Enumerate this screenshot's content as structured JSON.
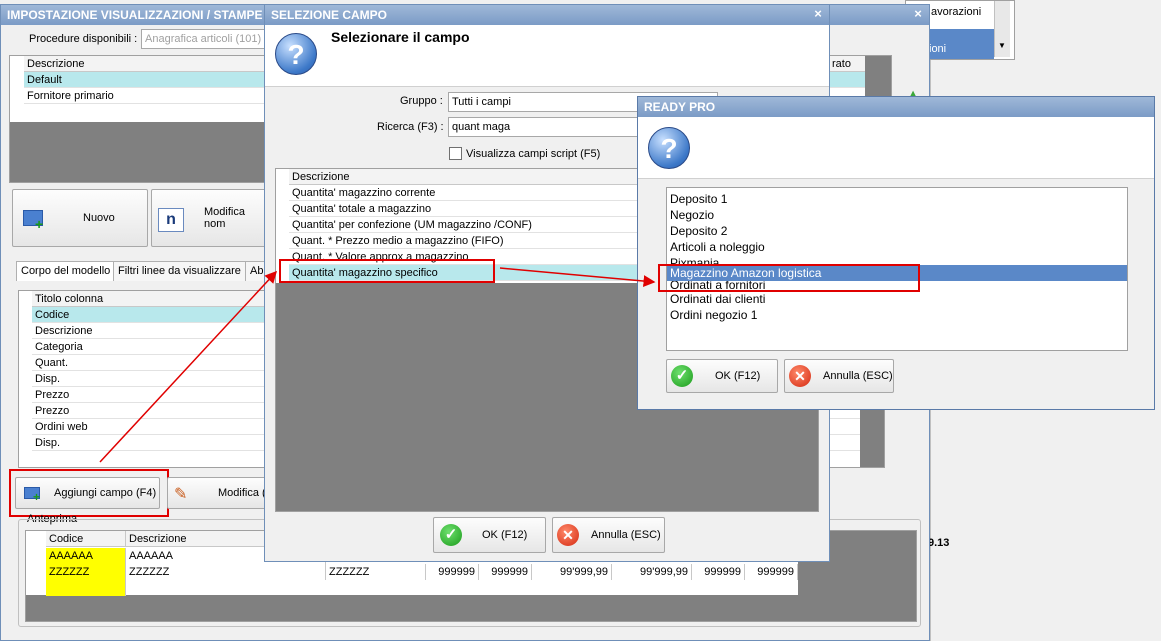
{
  "main_window": {
    "title": "IMPOSTAZIONE VISUALIZZAZIONI / STAMPE",
    "procedure_label": "Procedure disponibili :",
    "procedure_value": "Anagrafica articoli (101)",
    "grid_header": "Descrizione",
    "grid_header_right": "rato",
    "grid_rows": [
      "Default",
      "Fornitore primario"
    ],
    "btn_new": "Nuovo",
    "btn_rename": "Modifica nom",
    "tabs": [
      "Corpo del modello",
      "Filtri linee da visualizzare",
      "Abi"
    ],
    "columns_header": "Titolo colonna",
    "columns_rows": [
      "Codice",
      "Descrizione",
      "Categoria",
      "Quant.",
      "Disp.",
      "Prezzo",
      "Prezzo",
      "Ordini web",
      "Disp."
    ],
    "btn_add_field": "Aggiungi campo (F4)",
    "btn_edit": "Modifica (",
    "preview_label": "Anteprima",
    "preview_headers": [
      "Codice",
      "Descrizione"
    ],
    "preview_row1": [
      "AAAAAA",
      "AAAAAA"
    ],
    "preview_row2": [
      "ZZZZZZ",
      "ZZZZZZ",
      "ZZZZZZ",
      "999999",
      "999999",
      "99'999,99",
      "99'999,99",
      "999999",
      "999999"
    ]
  },
  "background_window": {
    "items": [
      "avorazioni",
      "ioni"
    ],
    "footer_value": "9.13"
  },
  "select_field_dialog": {
    "title": "SELEZIONE CAMPO",
    "heading": "Selezionare il campo",
    "group_label": "Gruppo :",
    "group_value": "Tutti i campi",
    "search_label": "Ricerca (F3) :",
    "search_value": "quant maga",
    "script_checkbox_label": "Visualizza campi script (F5)",
    "list_header": "Descrizione",
    "list_rows": [
      "Quantita' magazzino corrente",
      "Quantita' totale a magazzino",
      "Quantita' per confezione (UM magazzino /CONF)",
      "Quant. * Prezzo medio a magazzino (FIFO)",
      "Quant. * Valore approx a magazzino",
      "Quantita' magazzino specifico"
    ],
    "ok_label": "OK (F12)",
    "cancel_label": "Annulla (ESC)"
  },
  "ready_pro_dialog": {
    "title": "READY PRO",
    "list_items": [
      "Deposito 1",
      "Negozio",
      "Deposito 2",
      "Articoli a noleggio",
      "Pixmania",
      "Magazzino Amazon logistica",
      "Ordinati a fornitori",
      "Ordinati dai clienti",
      "Ordini negozio 1"
    ],
    "ok_label": "OK (F12)",
    "cancel_label": "Annulla (ESC)"
  },
  "colors": {
    "selection": "#b8e8ec",
    "ready_selection": "#5a88c8",
    "highlight_box": "#e00000",
    "yellow_cell": "#ffff00"
  }
}
